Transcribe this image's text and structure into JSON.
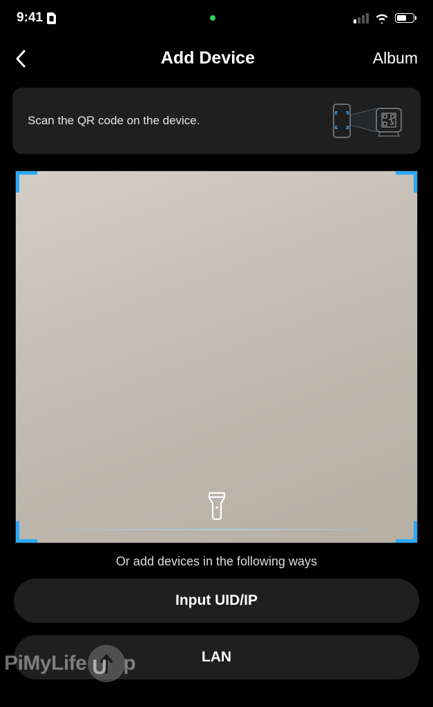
{
  "status": {
    "time": "9:41"
  },
  "header": {
    "title": "Add Device",
    "album": "Album"
  },
  "banner": {
    "text": "Scan the QR code on the device."
  },
  "orText": "Or add devices in the following ways",
  "buttons": {
    "inputUid": "Input UID/IP",
    "lan": "LAN"
  },
  "watermark": {
    "part1": "PiMyLife",
    "part2": "p"
  }
}
